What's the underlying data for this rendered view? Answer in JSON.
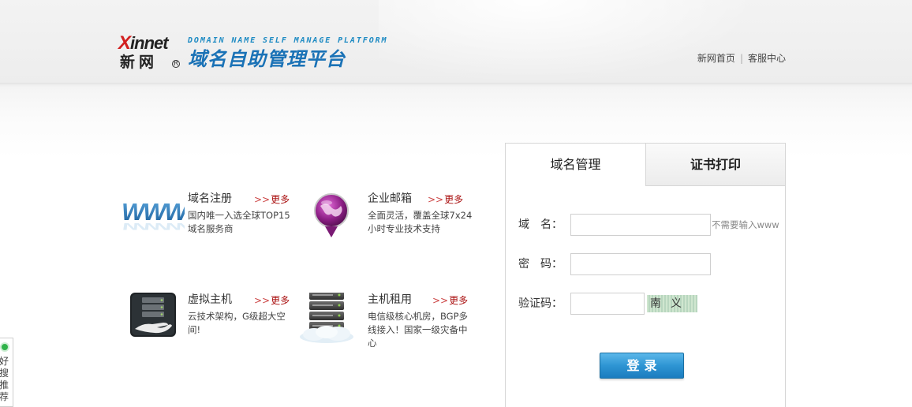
{
  "header": {
    "logo_en_x": "X",
    "logo_en_rest": "innet",
    "logo_cn": "新网",
    "logo_reg": "R",
    "platform_en": "DOMAIN NAME SELF MANAGE PLATFORM",
    "platform_cn": "域名自助管理平台",
    "links": [
      "新网首页",
      "客服中心"
    ],
    "link_separator": "|"
  },
  "services": [
    {
      "title": "域名注册",
      "more": "更多",
      "desc": "国内唯一入选全球TOP15域名服务商",
      "icon": "www-icon"
    },
    {
      "title": "企业邮箱",
      "more": "更多",
      "desc": "全面灵活，覆盖全球7x24小时专业技术支持",
      "icon": "mail-globe-icon"
    },
    {
      "title": "虚拟主机",
      "more": "更多",
      "desc": "云技术架构，G级超大空间!",
      "icon": "server-hand-icon"
    },
    {
      "title": "主机租用",
      "more": "更多",
      "desc": "电信级核心机房，BGP多线接入！国家一级灾备中心",
      "icon": "server-rack-icon"
    }
  ],
  "more_arrow": ">>",
  "login": {
    "tabs": [
      "域名管理",
      "证书打印"
    ],
    "domain_label": "域　名：",
    "domain_value": "",
    "domain_hint": "不需要输入www",
    "password_label": "密　码：",
    "password_value": "",
    "captcha_label": "验证码：",
    "captcha_value": "",
    "captcha_text": "南义",
    "submit_label": "登录"
  },
  "side_widget": {
    "text": "好搜推荐"
  },
  "colors": {
    "brand_blue": "#1a72b6",
    "accent_red": "#d21f1f",
    "button_blue": "#2e95d3"
  }
}
